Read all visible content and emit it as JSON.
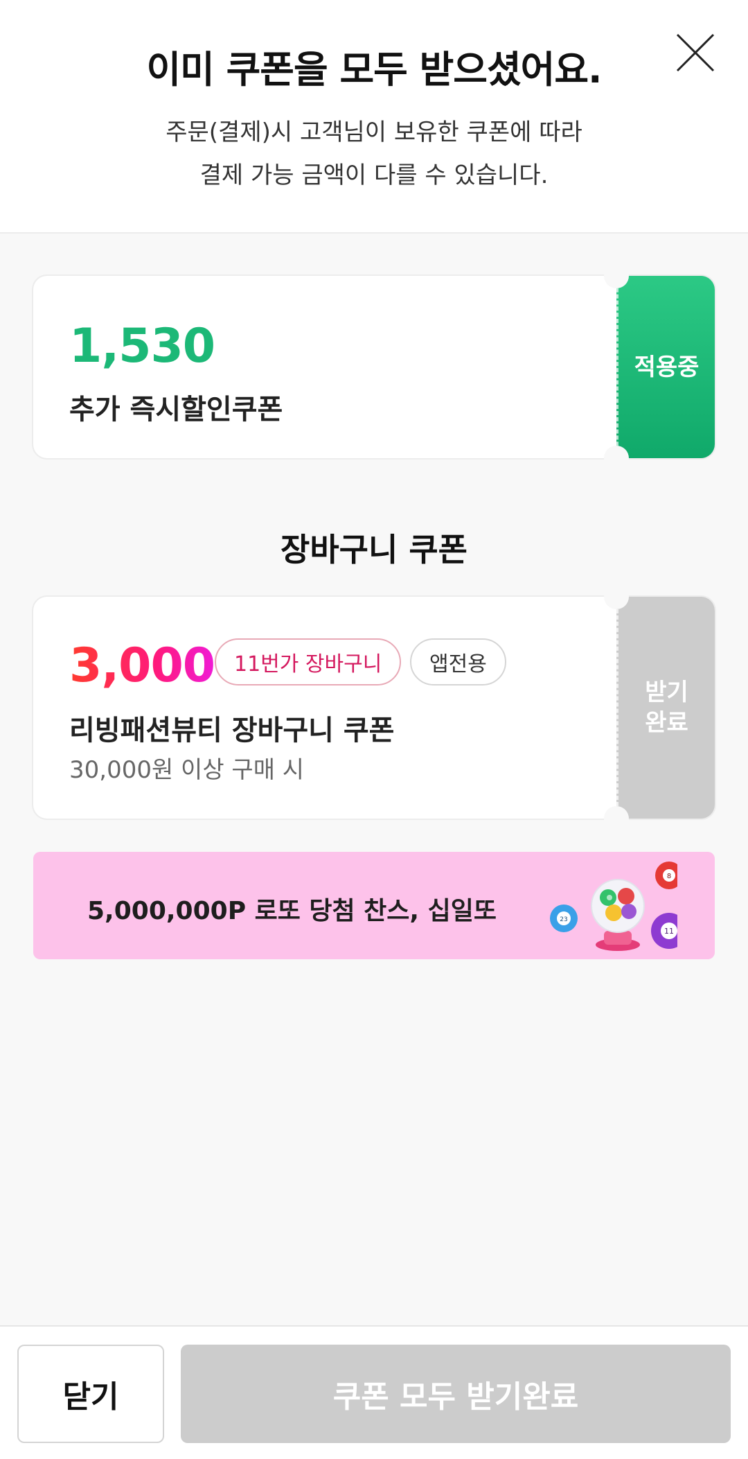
{
  "header": {
    "title": "이미 쿠폰을 모두 받으셨어요.",
    "subtitle_line1": "주문(결제)시 고객님이 보유한 쿠폰에 따라",
    "subtitle_line2": "결제 가능 금액이 다를 수 있습니다."
  },
  "applied_coupon": {
    "amount": "1,530",
    "name": "추가 즉시할인쿠폰",
    "status": "적용중",
    "accent": "#1cb877"
  },
  "cart_section": {
    "title": "장바구니 쿠폰",
    "coupon": {
      "amount": "3,000",
      "tag1": "11번가 장바구니",
      "tag2": "앱전용",
      "name": "리빙패션뷰티 장바구니 쿠폰",
      "condition": "30,000원 이상 구매 시",
      "status_line1": "받기",
      "status_line2": "완료"
    }
  },
  "banner": {
    "text": "5,000,000P 로또 당첨 찬스, 십일또",
    "ball_labels": [
      "23",
      "8",
      "11"
    ],
    "background": "#fdc2ea"
  },
  "footer": {
    "close_label": "닫기",
    "all_label": "쿠폰 모두 받기완료"
  }
}
